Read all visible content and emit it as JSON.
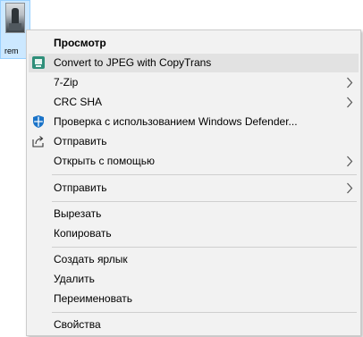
{
  "desktop": {
    "file_label": "rem"
  },
  "menu": {
    "items": [
      {
        "label": "Просмотр"
      },
      {
        "label": "Convert to JPEG with CopyTrans"
      },
      {
        "label": "7-Zip"
      },
      {
        "label": "CRC SHA"
      },
      {
        "label": "Проверка с использованием Windows Defender..."
      },
      {
        "label": "Отправить"
      },
      {
        "label": "Открыть с помощью"
      },
      {
        "label": "Отправить"
      },
      {
        "label": "Вырезать"
      },
      {
        "label": "Копировать"
      },
      {
        "label": "Создать ярлык"
      },
      {
        "label": "Удалить"
      },
      {
        "label": "Переименовать"
      },
      {
        "label": "Свойства"
      }
    ],
    "icons": {
      "convert": "copytrans-icon",
      "defender": "windows-defender-icon",
      "share": "share-icon",
      "submenu": "chevron-right-icon"
    },
    "colors": {
      "background": "#f2f2f2",
      "highlight": "#e2e2e2",
      "separator": "#cfcfcf",
      "defender_blue": "#1a73c8",
      "copytrans_green": "#2f8f7a"
    }
  }
}
